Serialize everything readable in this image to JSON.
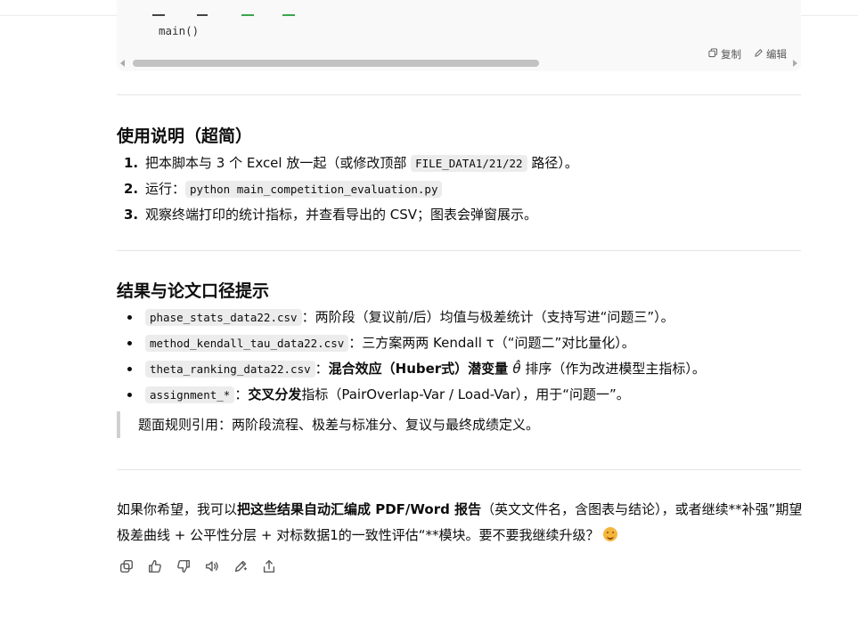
{
  "code": {
    "line": "main()",
    "copy_label": "复制",
    "edit_label": "编辑"
  },
  "usage": {
    "title": "使用说明（超简）",
    "items": [
      {
        "num": "1.",
        "pre": "把本脚本与 3 个 Excel 放一起（或修改顶部 ",
        "code": "FILE_DATA1/21/22",
        "post": " 路径）。"
      },
      {
        "num": "2.",
        "pre": "运行：",
        "code": "python main_competition_evaluation.py",
        "post": ""
      },
      {
        "num": "3.",
        "pre": "观察终端打印的统计指标，并查看导出的 CSV；图表会弹窗展示。",
        "code": "",
        "post": ""
      }
    ]
  },
  "results": {
    "title": "结果与论文口径提示",
    "items": [
      {
        "code": "phase_stats_data22.csv",
        "text": "：两阶段（复议前/后）均值与极差统计（支持写进“问题三”）。"
      },
      {
        "code": "method_kendall_tau_data22.csv",
        "text": "：三方案两两 Kendall τ（“问题二”对比量化）。"
      },
      {
        "code": "theta_ranking_data22.csv",
        "sep": "：",
        "bold1": "混合效应（Huber式）潜变量 ",
        "theta": "θ̂",
        "rest": " 排序（作为改进模型主指标）。"
      },
      {
        "code": "assignment_*",
        "sep": "：",
        "bold1": "交叉分发",
        "rest": "指标（PairOverlap-Var / Load-Var），用于“问题一”。"
      }
    ],
    "quote": "题面规则引用：两阶段流程、极差与标准分、复议与最终成绩定义。"
  },
  "closing": {
    "pre": "如果你希望，我可以",
    "bold": "把这些结果自动汇编成 PDF/Word 报告",
    "post": "（英文文件名，含图表与结论），或者继续**补强”期望极差曲线 + 公平性分层 + 对标数据1的一致性评估“**模块。要不要我继续升级？",
    "emoji": "smiling-face-emoji"
  },
  "toolbar": {
    "icons": [
      "copy-icon",
      "thumbs-up-icon",
      "thumbs-down-icon",
      "read-aloud-icon",
      "edit-icon",
      "share-icon"
    ]
  }
}
